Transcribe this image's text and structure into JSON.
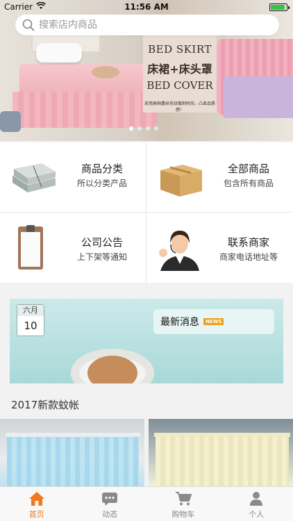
{
  "status_bar": {
    "carrier": "Carrier",
    "time": "11:56 AM"
  },
  "search": {
    "placeholder": "搜索店内商品"
  },
  "banner": {
    "line1": "BED SKIRT",
    "line2": "床裙+床头罩",
    "line3": "BED COVER",
    "line4": "采用高档蕾丝花纹做刺时尚，凸显品质感！",
    "slides": 4,
    "active_slide": 0
  },
  "menu": [
    {
      "title": "商品分类",
      "subtitle": "所以分类产品",
      "icon": "folded-fabric-icon"
    },
    {
      "title": "全部商品",
      "subtitle": "包含所有商品",
      "icon": "cardboard-box-icon"
    },
    {
      "title": "公司公告",
      "subtitle": "上下架等通知",
      "icon": "clipboard-icon"
    },
    {
      "title": "联系商家",
      "subtitle": "商家电话地址等",
      "icon": "customer-service-icon"
    }
  ],
  "news": {
    "month": "六月",
    "day": "10",
    "label": "最新消息",
    "badge": "NEWS"
  },
  "section": {
    "title": "2017新款蚊帐"
  },
  "tabs": [
    {
      "label": "首页",
      "icon": "home-icon",
      "active": true
    },
    {
      "label": "动态",
      "icon": "chat-icon",
      "active": false
    },
    {
      "label": "购物车",
      "icon": "cart-icon",
      "active": false
    },
    {
      "label": "个人",
      "icon": "person-icon",
      "active": false
    }
  ],
  "colors": {
    "accent": "#f0781e",
    "battery": "#35c24a",
    "news_badge": "#e8a21d"
  }
}
